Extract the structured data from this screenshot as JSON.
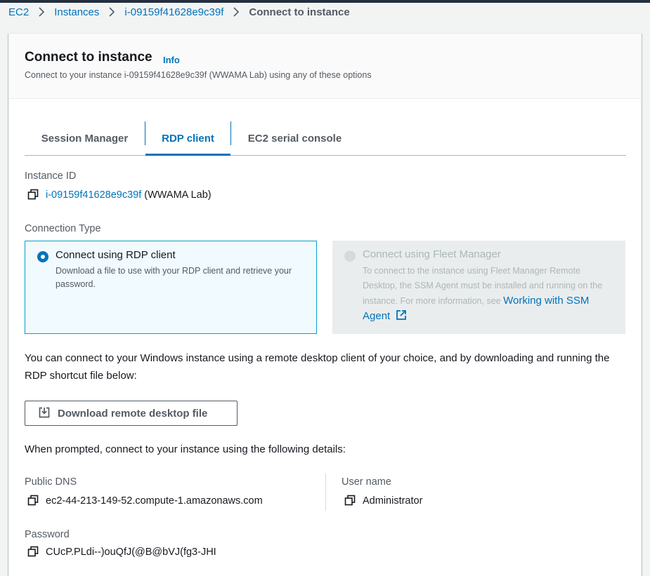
{
  "breadcrumb": {
    "items": [
      "EC2",
      "Instances",
      "i-09159f41628e9c39f"
    ],
    "current": "Connect to instance"
  },
  "header": {
    "title": "Connect to instance",
    "info": "Info",
    "description": "Connect to your instance i-09159f41628e9c39f (WWAMA Lab) using any of these options"
  },
  "tabs": [
    {
      "label": "Session Manager",
      "active": false
    },
    {
      "label": "RDP client",
      "active": true
    },
    {
      "label": "EC2 serial console",
      "active": false
    }
  ],
  "instance": {
    "label": "Instance ID",
    "id": "i-09159f41628e9c39f",
    "name": "(WWAMA Lab)"
  },
  "connection_type": {
    "label": "Connection Type",
    "options": [
      {
        "title": "Connect using RDP client",
        "description": "Download a file to use with your RDP client and retrieve your password.",
        "selected": true
      },
      {
        "title": "Connect using Fleet Manager",
        "description": "To connect to the instance using Fleet Manager Remote Desktop, the SSM Agent must be installed and running on the instance. For more information, see",
        "link": "Working with SSM Agent",
        "selected": false,
        "disabled": true
      }
    ]
  },
  "intro_text": "You can connect to your Windows instance using a remote desktop client of your choice, and by downloading and running the RDP shortcut file below:",
  "download_button": "Download remote desktop file",
  "prompt_text": "When prompted, connect to your instance using the following details:",
  "details": {
    "public_dns_label": "Public DNS",
    "public_dns": "ec2-44-213-149-52.compute-1.amazonaws.com",
    "username_label": "User name",
    "username": "Administrator",
    "password_label": "Password",
    "password": "CUcP.PLdi--)ouQfJ(@B@bVJ(fg3-JHI"
  },
  "colors": {
    "link": "#0073bb",
    "selected_border": "#00a1c9",
    "selected_bg": "#f1faff",
    "disabled_bg": "#eaeded",
    "topbar": "#232f3e"
  }
}
